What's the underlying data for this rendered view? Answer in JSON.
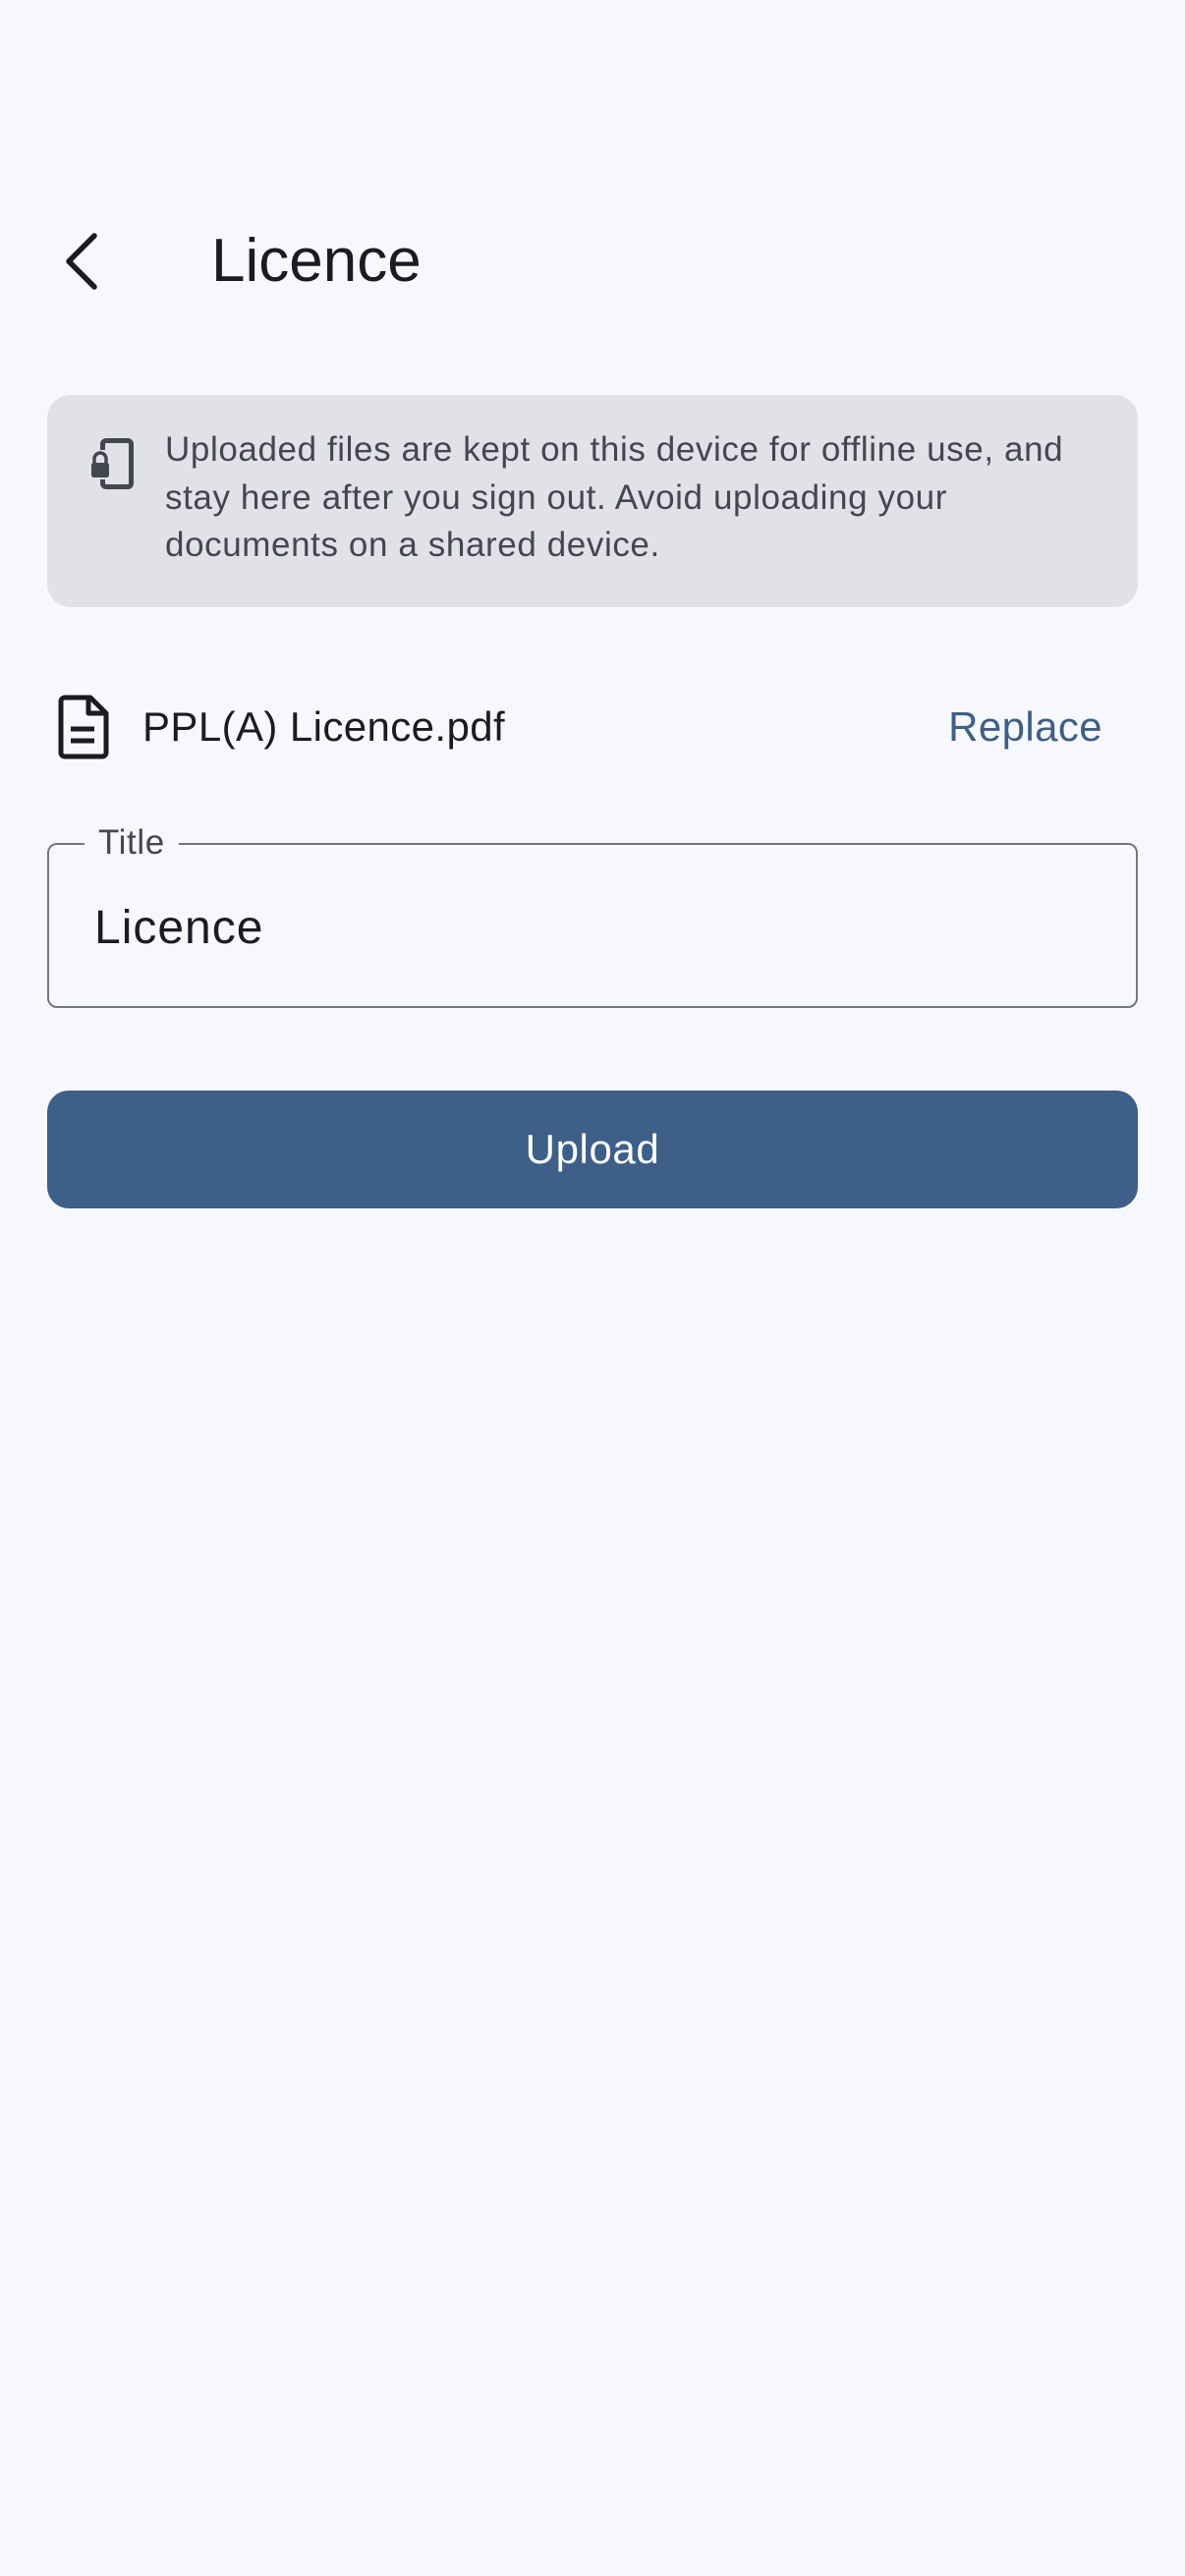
{
  "app_bar": {
    "title": "Licence",
    "back_icon": "chevron-left-icon"
  },
  "info_banner": {
    "icon": "phone-lock-icon",
    "text": "Uploaded files are kept on this device for offline use, and stay here after you sign out. Avoid uploading your documents on a shared device."
  },
  "file": {
    "icon": "document-icon",
    "name": "PPL(A) Licence.pdf",
    "replace_label": "Replace"
  },
  "title_field": {
    "label": "Title",
    "value": "Licence"
  },
  "upload_button": {
    "label": "Upload"
  },
  "colors": {
    "background": "#f7f8fd",
    "primary": "#3d5f88",
    "banner": "#e1e2e8",
    "outline": "#74777f"
  }
}
